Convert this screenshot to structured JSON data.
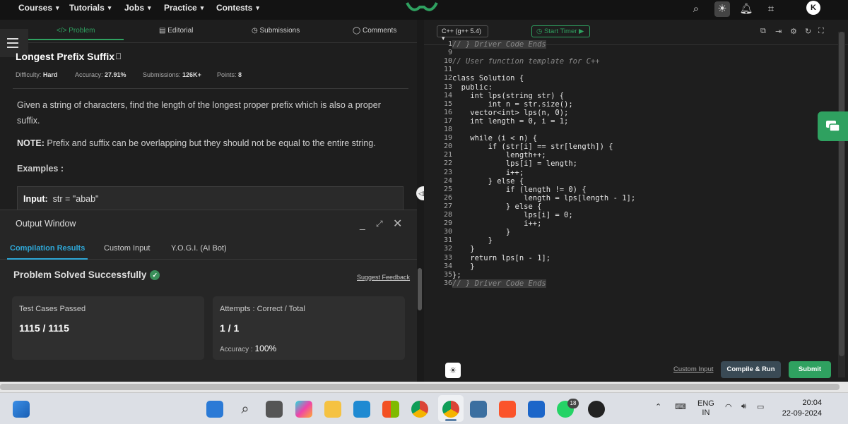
{
  "nav": {
    "items": [
      "Courses",
      "Tutorials",
      "Jobs",
      "Practice",
      "Contests"
    ],
    "chevron": "chevron-down-icon",
    "avatar": "K"
  },
  "problem": {
    "tabs": [
      "Problem",
      "Editorial",
      "Submissions",
      "Comments"
    ],
    "tab_icons": [
      "code-icon",
      "document-icon",
      "clock-icon",
      "comment-icon"
    ],
    "title": "Longest Prefix Suffix",
    "difficulty_label": "Difficulty:",
    "difficulty": "Hard",
    "accuracy_label": "Accuracy:",
    "accuracy": "27.91%",
    "submissions_label": "Submissions:",
    "submissions": "126K+",
    "points_label": "Points:",
    "points": "8",
    "description": "Given a string of characters, find the length of the longest proper prefix which is also a proper suffix.",
    "note_label": "NOTE:",
    "note": "Prefix and suffix can be overlapping but they should not be equal to the entire string.",
    "examples_heading": "Examples :",
    "example_input_label": "Input:",
    "example_input": "str = \"abab\""
  },
  "output": {
    "title": "Output Window",
    "tabs": [
      "Compilation Results",
      "Custom Input",
      "Y.O.G.I. (AI Bot)"
    ],
    "status": "Problem Solved Successfully",
    "feedback": "Suggest Feedback",
    "cards": {
      "test_label": "Test Cases Passed",
      "test_value": "1115 / 1115",
      "attempts_label": "Attempts : Correct / Total",
      "attempts_value": "1 / 1",
      "accuracy_label": "Accuracy :",
      "accuracy_value": "100%"
    }
  },
  "editor": {
    "language": "C++ (g++ 5.4)",
    "timer": "Start Timer",
    "custom_input": "Custom Input",
    "run": "Compile & Run",
    "submit": "Submit",
    "lines": [
      {
        "n": "1",
        "t": "// } Driver Code Ends",
        "c": "comment hl"
      },
      {
        "n": "9",
        "t": "",
        "c": ""
      },
      {
        "n": "10",
        "t": "// User function template for C++",
        "c": "comment"
      },
      {
        "n": "11",
        "t": "",
        "c": ""
      },
      {
        "n": "12",
        "t": "class Solution {",
        "c": ""
      },
      {
        "n": "13",
        "t": "  public:",
        "c": ""
      },
      {
        "n": "14",
        "t": "    int lps(string str) {",
        "c": ""
      },
      {
        "n": "15",
        "t": "        int n = str.size();",
        "c": ""
      },
      {
        "n": "16",
        "t": "    vector<int> lps(n, 0);",
        "c": ""
      },
      {
        "n": "17",
        "t": "    int length = 0, i = 1;",
        "c": ""
      },
      {
        "n": "18",
        "t": "",
        "c": ""
      },
      {
        "n": "19",
        "t": "    while (i < n) {",
        "c": ""
      },
      {
        "n": "20",
        "t": "        if (str[i] == str[length]) {",
        "c": ""
      },
      {
        "n": "21",
        "t": "            length++;",
        "c": ""
      },
      {
        "n": "22",
        "t": "            lps[i] = length;",
        "c": ""
      },
      {
        "n": "23",
        "t": "            i++;",
        "c": ""
      },
      {
        "n": "24",
        "t": "        } else {",
        "c": ""
      },
      {
        "n": "25",
        "t": "            if (length != 0) {",
        "c": ""
      },
      {
        "n": "26",
        "t": "                length = lps[length - 1];",
        "c": ""
      },
      {
        "n": "27",
        "t": "            } else {",
        "c": ""
      },
      {
        "n": "28",
        "t": "                lps[i] = 0;",
        "c": ""
      },
      {
        "n": "29",
        "t": "                i++;",
        "c": ""
      },
      {
        "n": "30",
        "t": "            }",
        "c": ""
      },
      {
        "n": "31",
        "t": "        }",
        "c": ""
      },
      {
        "n": "32",
        "t": "    }",
        "c": ""
      },
      {
        "n": "33",
        "t": "    return lps[n - 1];",
        "c": ""
      },
      {
        "n": "34",
        "t": "    }",
        "c": ""
      },
      {
        "n": "35",
        "t": "};",
        "c": ""
      },
      {
        "n": "36",
        "t": "// } Driver Code Ends",
        "c": "comment hl"
      }
    ]
  },
  "taskbar": {
    "apps": [
      "windows-start-icon",
      "search-icon",
      "task-view-icon",
      "copilot-icon",
      "file-explorer-icon",
      "vscode-icon",
      "store-icon",
      "chrome-icon",
      "chrome-profile-icon",
      "task-manager-icon",
      "brave-icon",
      "mail-icon",
      "whatsapp-icon",
      "wordpress-icon"
    ],
    "whatsapp_badge": "18",
    "lang_top": "ENG",
    "lang_bottom": "IN",
    "time": "20:04",
    "date": "22-09-2024"
  },
  "colors": {
    "accent_green": "#2fa160",
    "accent_blue": "#2fa8d8",
    "panel_bg": "#1e1e1e"
  }
}
